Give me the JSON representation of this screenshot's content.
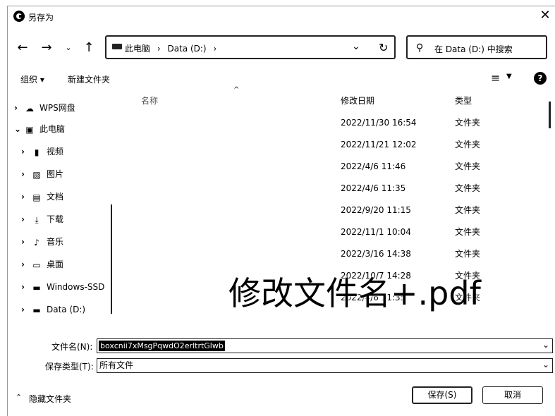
{
  "window": {
    "title": "另存为"
  },
  "address": {
    "segments": [
      "此电脑",
      "›",
      "Data (D:)",
      "›"
    ]
  },
  "search": {
    "placeholder": "在 Data (D:) 中搜索"
  },
  "toolbar": {
    "organize": "组织 ▾",
    "new_folder": "新建文件夹"
  },
  "nav_pane": {
    "items": [
      {
        "label": "WPS网盘",
        "icon": "cloud-icon",
        "level": 0,
        "chevron": "›"
      },
      {
        "label": "此电脑",
        "icon": "computer-icon",
        "level": 0,
        "chevron": "⌄"
      },
      {
        "label": "视频",
        "icon": "video-icon",
        "level": 1,
        "chevron": "›"
      },
      {
        "label": "图片",
        "icon": "picture-icon",
        "level": 1,
        "chevron": "›"
      },
      {
        "label": "文档",
        "icon": "document-icon",
        "level": 1,
        "chevron": "›"
      },
      {
        "label": "下载",
        "icon": "download-icon",
        "level": 1,
        "chevron": "›"
      },
      {
        "label": "音乐",
        "icon": "music-icon",
        "level": 1,
        "chevron": "›"
      },
      {
        "label": "桌面",
        "icon": "desktop-icon",
        "level": 1,
        "chevron": "›"
      },
      {
        "label": "Windows-SSD",
        "icon": "drive-icon",
        "level": 1,
        "chevron": "›"
      },
      {
        "label": "Data (D:)",
        "icon": "drive-icon",
        "level": 1,
        "chevron": "›"
      }
    ]
  },
  "columns": {
    "name": "名称",
    "date": "修改日期",
    "type": "类型"
  },
  "files": [
    {
      "date": "2022/11/30 16:54",
      "type": "文件夹"
    },
    {
      "date": "2022/11/21 12:02",
      "type": "文件夹"
    },
    {
      "date": "2022/4/6 11:46",
      "type": "文件夹"
    },
    {
      "date": "2022/4/6 11:35",
      "type": "文件夹"
    },
    {
      "date": "2022/9/20 11:15",
      "type": "文件夹"
    },
    {
      "date": "2022/11/1 10:04",
      "type": "文件夹"
    },
    {
      "date": "2022/3/16 14:38",
      "type": "文件夹"
    },
    {
      "date": "2022/10/7 14:28",
      "type": "文件夹"
    },
    {
      "date": "2022/4/6 11:35",
      "type": "文件夹"
    }
  ],
  "overlay_annotation": "修改文件名+.pdf",
  "filename": {
    "label": "文件名(N):",
    "value": "boxcnii7xMsgPqwdO2erltrtGlwb"
  },
  "filetype": {
    "label": "保存类型(T):",
    "value": "所有文件"
  },
  "footer": {
    "hide_folders": "隐藏文件夹",
    "save": "保存(S)",
    "cancel": "取消"
  }
}
